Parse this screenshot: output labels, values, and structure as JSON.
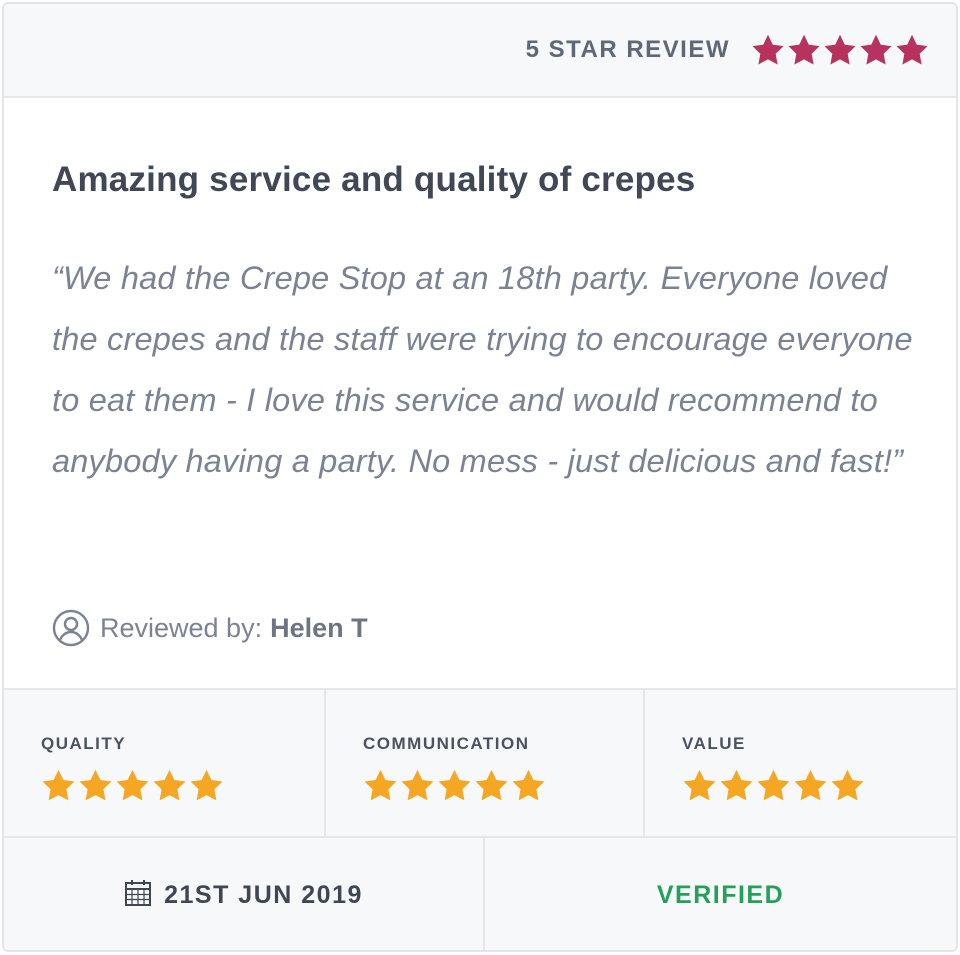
{
  "header": {
    "label": "5 STAR REVIEW",
    "rating": 5,
    "star_color": "#b8325e"
  },
  "review": {
    "title": "Amazing service and quality of crepes",
    "body": "“We had the Crepe Stop at an 18th party. Everyone loved the crepes and the staff were trying to encourage everyone to eat them - I love this service and would recommend to anybody having a party. No mess - just delicious and fast!”",
    "reviewer_label": "Reviewed by:",
    "reviewer_name": "Helen T",
    "reviewer_icon": "user-circle-icon"
  },
  "ratings": [
    {
      "label": "QUALITY",
      "rating": 5
    },
    {
      "label": "COMMUNICATION",
      "rating": 5
    },
    {
      "label": "VALUE",
      "rating": 5
    }
  ],
  "rating_star_color": "#f5a623",
  "footer": {
    "date": "21ST JUN 2019",
    "date_icon": "calendar-icon",
    "verified": "VERIFIED",
    "verified_color": "#24a05a"
  }
}
